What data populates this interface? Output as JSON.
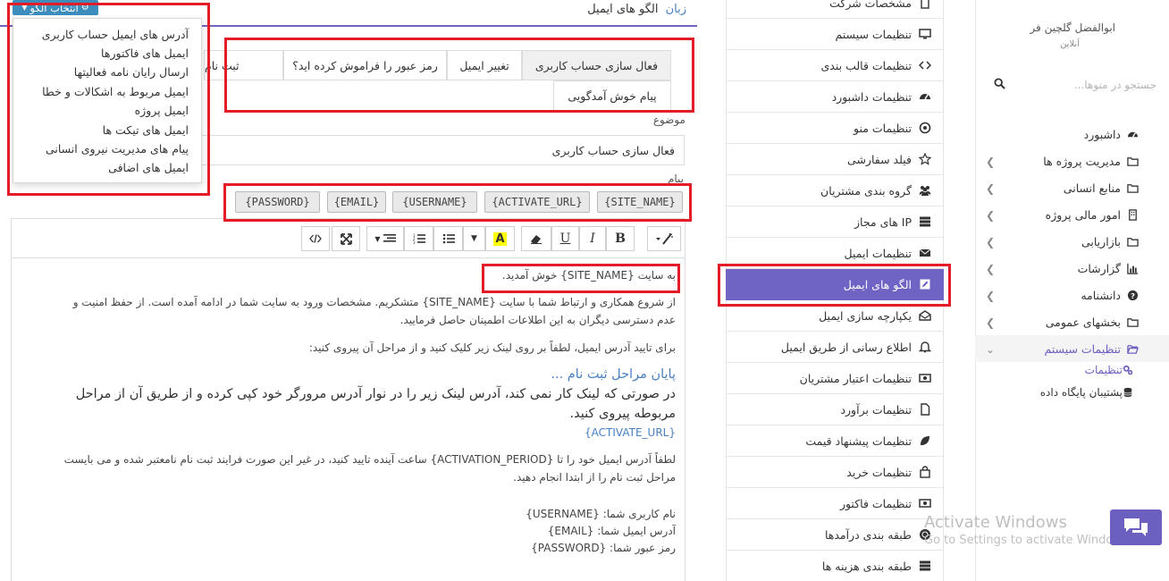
{
  "user": {
    "name": "ابوالفضل گلچین فر",
    "status": "آنلاین"
  },
  "search": {
    "placeholder": "جستجو در منوها..."
  },
  "main_menu": [
    {
      "label": "داشبورد",
      "icon": "dashboard-icon"
    },
    {
      "label": "مدیریت پروژه ها",
      "icon": "folder-icon"
    },
    {
      "label": "منابع انسانی",
      "icon": "folder-icon"
    },
    {
      "label": "امور مالی پروژه",
      "icon": "building-icon"
    },
    {
      "label": "بازاریابی",
      "icon": "folder-icon"
    },
    {
      "label": "گزارشات",
      "icon": "bar-chart-icon"
    },
    {
      "label": "دانشنامه",
      "icon": "question-icon"
    },
    {
      "label": "بخشهای عمومی",
      "icon": "folder-icon"
    },
    {
      "label": "تنظیمات سیستم",
      "icon": "folder-open-icon"
    }
  ],
  "main_submenu": [
    {
      "label": "تنظیمات",
      "icon": "gears-icon"
    },
    {
      "label": "پشتیبان پایگاه داده",
      "icon": "database-icon"
    }
  ],
  "settings_list": [
    {
      "label": "مشخصات شرکت",
      "icon": "building-icon"
    },
    {
      "label": "تنظیمات سیستم",
      "icon": "desktop-icon"
    },
    {
      "label": "تنظیمات قالب بندی",
      "icon": "code-icon"
    },
    {
      "label": "تنظیمات داشبورد",
      "icon": "dashboard-icon"
    },
    {
      "label": "تنظیمات منو",
      "icon": "compass-icon"
    },
    {
      "label": "فیلد سفارشی",
      "icon": "star-icon"
    },
    {
      "label": "گروه بندی مشتریان",
      "icon": "users-icon"
    },
    {
      "label": "IP های مجاز",
      "icon": "server-icon"
    },
    {
      "label": "تنظیمات ایمیل",
      "icon": "envelope-icon"
    },
    {
      "label": "الگو های ایمیل",
      "icon": "edit-icon"
    },
    {
      "label": "یکپارچه سازی ایمیل",
      "icon": "envelope-open-icon"
    },
    {
      "label": "اطلاع رسانی از طریق ایمیل",
      "icon": "bell-icon"
    },
    {
      "label": "تنظیمات اعتبار مشتریان",
      "icon": "money-icon"
    },
    {
      "label": "تنظیمات برآورد",
      "icon": "file-icon"
    },
    {
      "label": "تنظیمات پیشنهاد قیمت",
      "icon": "leaf-icon"
    },
    {
      "label": "تنظیمات خرید",
      "icon": "shopping-bag-icon"
    },
    {
      "label": "تنظیمات فاکتور",
      "icon": "money-icon"
    },
    {
      "label": "طبقه بندی درآمدها",
      "icon": "certificate-icon"
    },
    {
      "label": "طبقه بندی هزینه ها",
      "icon": "server-icon"
    }
  ],
  "page_title": {
    "lang": "زبان",
    "title": "الگو های ایمیل"
  },
  "pattern_button": {
    "label": "انتخاب الگو"
  },
  "pattern_menu": [
    "آدرس های ایمیل حساب کاربری",
    "ایمیل های فاکتورها",
    "ارسال رایان نامه فعالیتها",
    "ایمیل مربوط به اشکالات و خطا",
    "ایمیل پروژه",
    "ایمیل های تیکت ها",
    "پیام های مدیریت نیروی انسانی",
    "ایمیل های اضافی"
  ],
  "tabs": [
    {
      "label": "فعال سازی حساب کاربری"
    },
    {
      "label": "تغییر ایمیل"
    },
    {
      "label": "رمز عبور را فراموش کرده اید؟"
    },
    {
      "label": "ثبت نام"
    },
    {
      "label": "پیام خوش آمدگویی"
    }
  ],
  "form": {
    "subject_label": "موضوع",
    "subject_value": "فعال سازی حساب کاربری",
    "message_label": "پیام"
  },
  "tokens": [
    "{SITE_NAME}",
    "{ACTIVATE_URL}",
    "{USERNAME}",
    "{EMAIL}",
    "{PASSWORD}"
  ],
  "toolbar": [
    {
      "name": "magic",
      "label": ""
    },
    {
      "name": "bold",
      "label": "B"
    },
    {
      "name": "italic",
      "label": "I"
    },
    {
      "name": "underline",
      "label": "U"
    },
    {
      "name": "eraser",
      "label": ""
    },
    {
      "name": "color",
      "label": "A"
    },
    {
      "name": "ul",
      "label": ""
    },
    {
      "name": "ol",
      "label": ""
    },
    {
      "name": "align",
      "label": ""
    },
    {
      "name": "fullscreen",
      "label": ""
    },
    {
      "name": "codeview",
      "label": ""
    }
  ],
  "body_lines": {
    "welcome": "به سایت {SITE_NAME} خوش آمدید.",
    "p1_line1": "از شروع همکاری و ارتباط شما با سایت {SITE_NAME} متشکریم. مشخصات ورود به سایت شما در ادامه آمده است. از حفظ امنیت و",
    "p1_line2": "عدم دسترسی دیگران به این اطلاعات اطمینان حاصل فرمایید.",
    "p2": "برای تایید آدرس ایمیل، لطفاً بر روی لینک زیر کلیک کنید و از مراحل آن پیروی کنید:",
    "link_text": "پایان مراحل ثبت نام ...",
    "big_line1": "در صورتی که لینک کار نمی کند، آدرس لینک زیر را در نوار آدرس مرورگر خود کپی کرده و از طریق آن از مراحل",
    "big_line2": "مربوطه پیروی کنید.",
    "activate_url": "{ACTIVATE_URL}",
    "p3_line1": "لطفاً آدرس ایمیل خود را تا {ACTIVATION_PERIOD} ساعت آینده تایید کنید، در غیر این صورت فرایند ثبت نام نامعتبر شده و می بایست",
    "p3_line2": "مراحل ثبت نام را از ابتدا انجام دهید.",
    "username_line": "نام کاربری شما: {USERNAME}",
    "email_line": "آدرس ایمیل شما: {EMAIL}",
    "password_line": "رمز عبور شما: {PASSWORD}"
  },
  "watermark": {
    "title": "Activate Windows",
    "subtitle": "Go to Settings to activate Windows."
  },
  "colors": {
    "accent": "#6f63c4",
    "highlight": "#e41c28",
    "link": "#4a7fc1",
    "button": "#3c8dbc"
  }
}
